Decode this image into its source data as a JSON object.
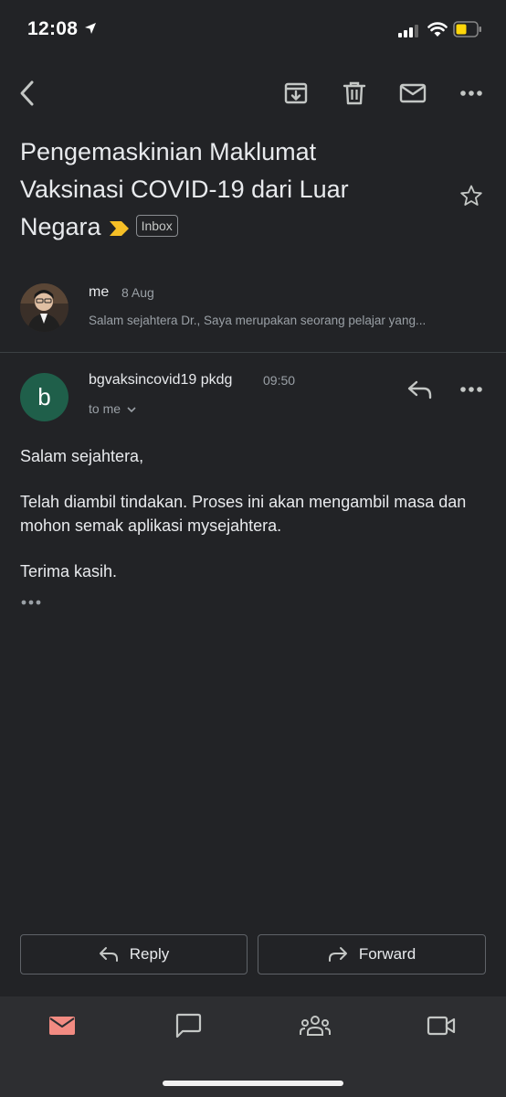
{
  "status_bar": {
    "time": "12:08"
  },
  "toolbar": {
    "back_icon": "chevron-left-icon",
    "archive_icon": "archive-icon",
    "delete_icon": "trash-icon",
    "mark_unread_icon": "mail-icon",
    "more_icon": "more-horizontal-icon"
  },
  "subject": {
    "line1": "Pengemaskinian Maklumat",
    "line2": "Vaksinasi COVID-19 dari Luar",
    "line3": "Negara",
    "label": "Inbox",
    "importance_color": "#f6bf26"
  },
  "messages": [
    {
      "sender": "me",
      "date": "8 Aug",
      "snippet": "Salam sejahtera Dr., Saya merupakan seorang pelajar yang..."
    },
    {
      "avatar_letter": "b",
      "avatar_color": "#1f5f4a",
      "sender": "bgvaksincovid19 pkdg",
      "time": "09:50",
      "recipients": "to me",
      "body": {
        "greeting": "Salam sejahtera,",
        "paragraph": "Telah diambil tindakan. Proses ini akan mengambil masa dan mohon semak aplikasi mysejahtera.",
        "closing": "Terima kasih."
      }
    }
  ],
  "actions": {
    "reply": "Reply",
    "forward": "Forward"
  },
  "bottom_nav": {
    "active": "mail",
    "active_color": "#f28b82",
    "items": [
      "mail-icon",
      "chat-icon",
      "spaces-icon",
      "meet-icon"
    ]
  }
}
